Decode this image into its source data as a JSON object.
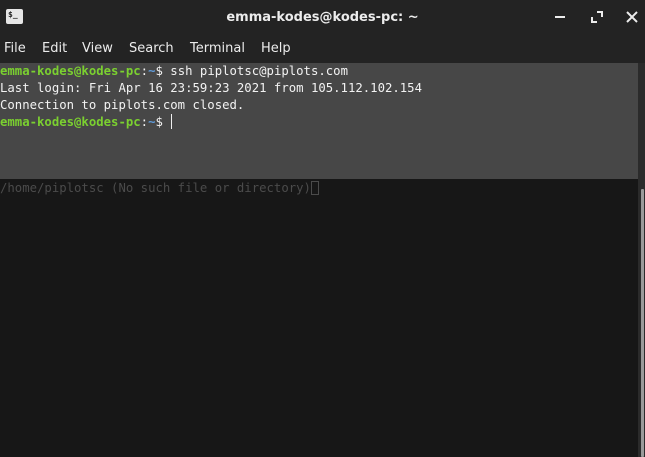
{
  "window": {
    "title": "emma-kodes@kodes-pc: ~",
    "app_icon": "terminal-icon",
    "app_icon_glyph": "$_",
    "controls": [
      "minimize-icon",
      "maximize-icon",
      "close-icon"
    ]
  },
  "menu": {
    "items": [
      {
        "label": "File"
      },
      {
        "label": "Edit"
      },
      {
        "label": "View"
      },
      {
        "label": "Search"
      },
      {
        "label": "Terminal"
      },
      {
        "label": "Help"
      }
    ]
  },
  "terminal": {
    "lines": [
      {
        "user_host": "emma-kodes@kodes-pc",
        "sep": ":",
        "path": "~",
        "symbol": "$ ",
        "command": "ssh piplotsc@piplots.com"
      },
      {
        "text": "Last login: Fri Apr 16 23:59:23 2021 from 105.112.102.154"
      },
      {
        "text": "Connection to piplots.com closed."
      },
      {
        "user_host": "emma-kodes@kodes-pc",
        "sep": ":",
        "path": "~",
        "symbol": "$ ",
        "command": ""
      }
    ],
    "background_message": "/home/piplotsc (No such file or directory)"
  },
  "colors": {
    "prompt_user": "#7bd030",
    "prompt_path": "#5f9ad8",
    "output_panel": "#474747",
    "background": "#171717",
    "text": "#f2f2f2"
  }
}
